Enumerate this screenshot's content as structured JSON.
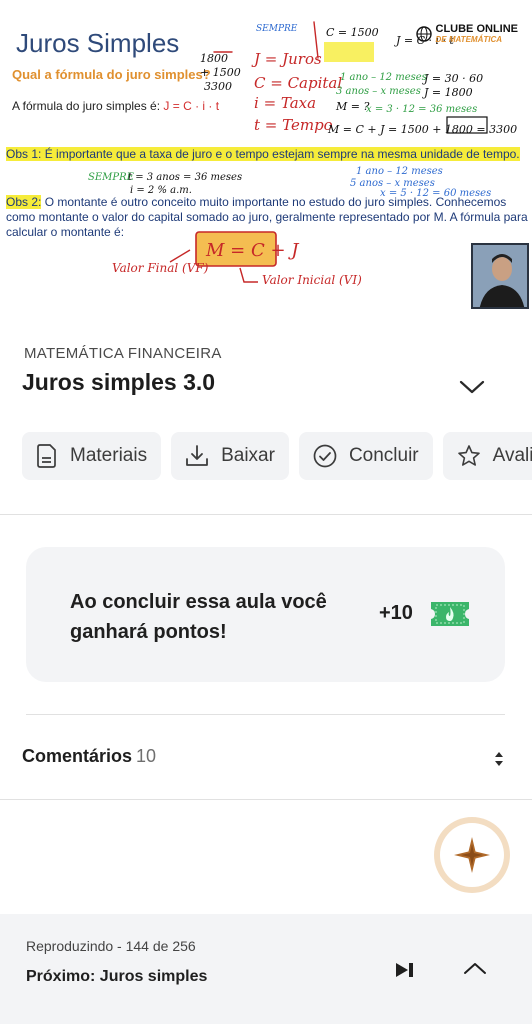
{
  "video": {
    "slide_title": "Juros Simples",
    "slide_question": "Qual a fórmula do juro simples?",
    "slide_formula_prefix": "A fórmula do juro simples é: ",
    "slide_formula": "J = C · i · t",
    "obs1_label": "Obs 1:",
    "obs1_text": " É importante que a taxa de juro e o tempo estejam sempre na mesma unidade de tempo.",
    "obs2_label": "Obs 2:",
    "obs2_text": " O montante é outro conceito muito importante no estudo do juro simples. Conhecemos como montante o valor do capital somado ao juro, geralmente representado por M. A fórmula para calcular o montante é:",
    "logo_line1": "CLUBE ONLINE",
    "logo_line2": "DE MATEMÁTICA",
    "ink_montante": "M = C + J",
    "ink_valor_final": "Valor Final (VF)",
    "ink_valor_inicial": "Valor Inicial (VI)",
    "ink_legend": [
      "J = Juros",
      "C = Capital",
      "i = Taxa",
      "t = Tempo"
    ],
    "ink_calc": "M = C + J = 1500 + 1800 = 3300"
  },
  "lesson": {
    "category": "MATEMÁTICA FINANCEIRA",
    "title": "Juros simples 3.0"
  },
  "actions": [
    {
      "label": "Materiais",
      "icon": "document-icon"
    },
    {
      "label": "Baixar",
      "icon": "download-icon"
    },
    {
      "label": "Concluir",
      "icon": "check-circle-icon"
    },
    {
      "label": "Avaliar",
      "icon": "star-icon"
    }
  ],
  "points": {
    "text": "Ao concluir essa aula você ganhará pontos!",
    "value": "+10",
    "accent": "#3bb56a"
  },
  "comments": {
    "label": "Comentários",
    "count": "10"
  },
  "player": {
    "status": "Reproduzindo - 144 de 256",
    "next": "Próximo: Juros simples"
  },
  "colors": {
    "fab_ring": "#f3ddc2",
    "fab_star": "#b06a2a",
    "highlight": "#f6ec3a",
    "ink_red": "#c62828"
  }
}
